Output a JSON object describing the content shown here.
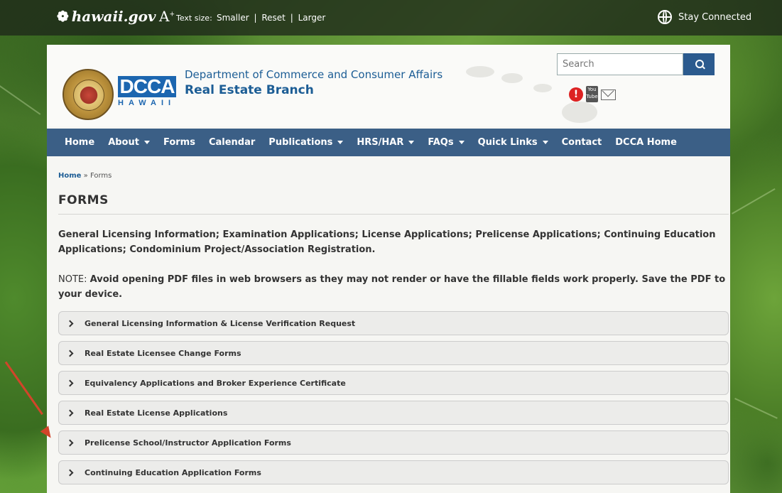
{
  "topbar": {
    "site_logo": "hawaii.gov",
    "textsize_label": "Text size:",
    "smaller": "Smaller",
    "reset": "Reset",
    "larger": "Larger",
    "separator": "|",
    "stay_connected": "Stay Connected"
  },
  "header": {
    "dcca_logo": "DCCA",
    "dcca_sub": "HAWAII",
    "department": "Department of Commerce and Consumer Affairs",
    "branch": "Real Estate Branch",
    "search_placeholder": "Search",
    "youtube_text": "You Tube"
  },
  "nav": {
    "items": [
      {
        "label": "Home",
        "dropdown": false
      },
      {
        "label": "About",
        "dropdown": true
      },
      {
        "label": "Forms",
        "dropdown": false
      },
      {
        "label": "Calendar",
        "dropdown": false
      },
      {
        "label": "Publications",
        "dropdown": true
      },
      {
        "label": "HRS/HAR",
        "dropdown": true
      },
      {
        "label": "FAQs",
        "dropdown": true
      },
      {
        "label": "Quick Links",
        "dropdown": true
      },
      {
        "label": "Contact",
        "dropdown": false
      },
      {
        "label": "DCCA Home",
        "dropdown": false
      }
    ]
  },
  "breadcrumb": {
    "home": "Home",
    "separator": "»",
    "current": "Forms"
  },
  "page": {
    "title": "FORMS",
    "intro": "General Licensing Information; Examination Applications; License Applications; Prelicense Applications; Continuing Education Applications; Condominium Project/Association Registration.",
    "note_prefix": "NOTE:",
    "note_text": "Avoid opening PDF files in web browsers as they may not render or have the fillable fields work properly. Save the PDF to your device."
  },
  "accordion": [
    "General Licensing Information & License Verification Request",
    "Real Estate Licensee Change Forms",
    "Equivalency Applications and Broker Experience Certificate",
    "Real Estate License Applications",
    "Prelicense School/Instructor Application Forms",
    "Continuing Education Application Forms"
  ],
  "colors": {
    "nav_bg": "#3b5f86",
    "brand_blue": "#1c5d95",
    "annotation_arrow": "#d2452a"
  }
}
